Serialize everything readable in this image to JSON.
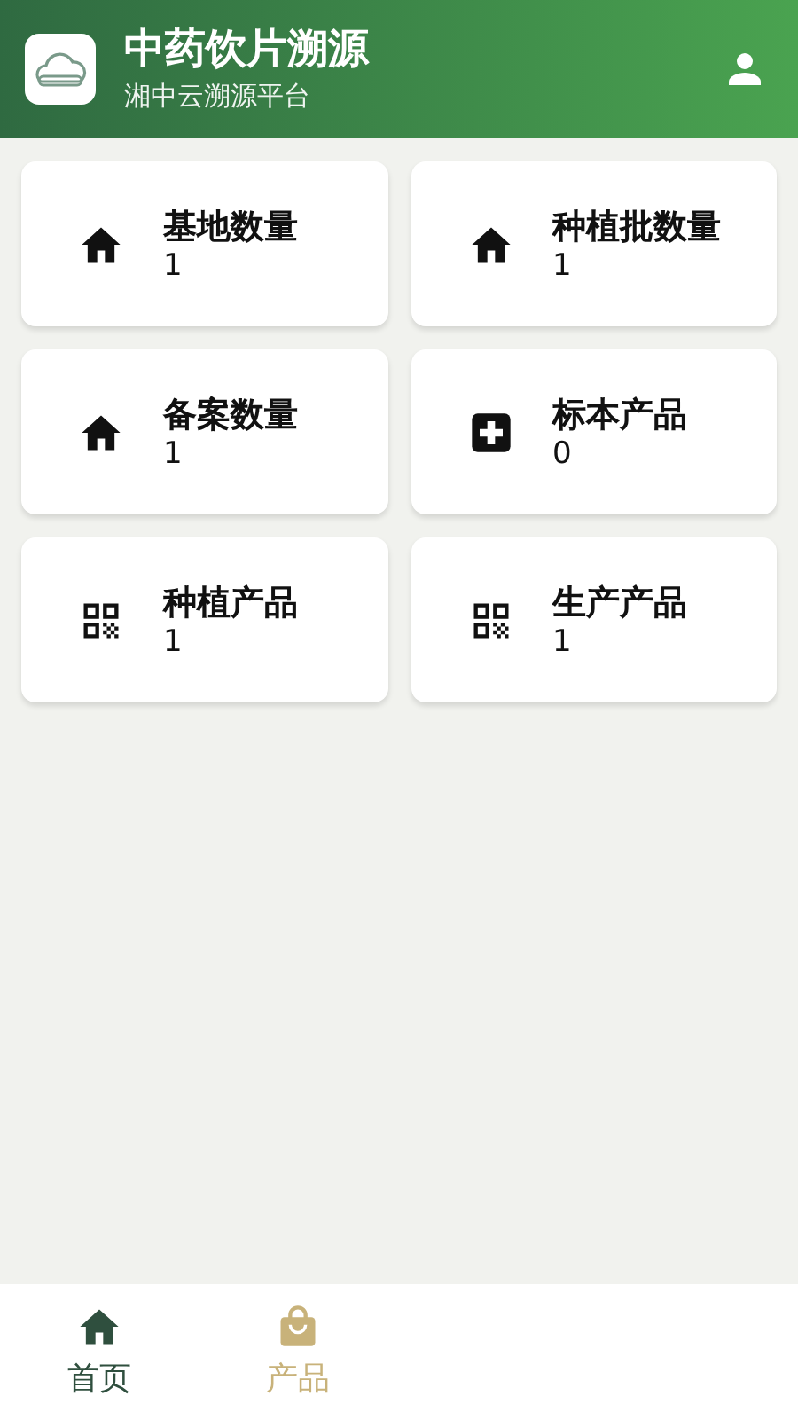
{
  "header": {
    "title": "中药饮片溯源",
    "subtitle": "湘中云溯源平台"
  },
  "stats": [
    {
      "label": "基地数量",
      "value": "1",
      "kind": "home"
    },
    {
      "label": "种植批数量",
      "value": "1",
      "kind": "home"
    },
    {
      "label": "备案数量",
      "value": "1",
      "kind": "home"
    },
    {
      "label": "标本产品",
      "value": "0",
      "kind": "plus"
    },
    {
      "label": "种植产品",
      "value": "1",
      "kind": "qr"
    },
    {
      "label": "生产产品",
      "value": "1",
      "kind": "qr"
    }
  ],
  "tabs": [
    {
      "label": "首页",
      "kind": "home",
      "selected": true
    },
    {
      "label": "产品",
      "kind": "bag",
      "selected": false
    }
  ]
}
